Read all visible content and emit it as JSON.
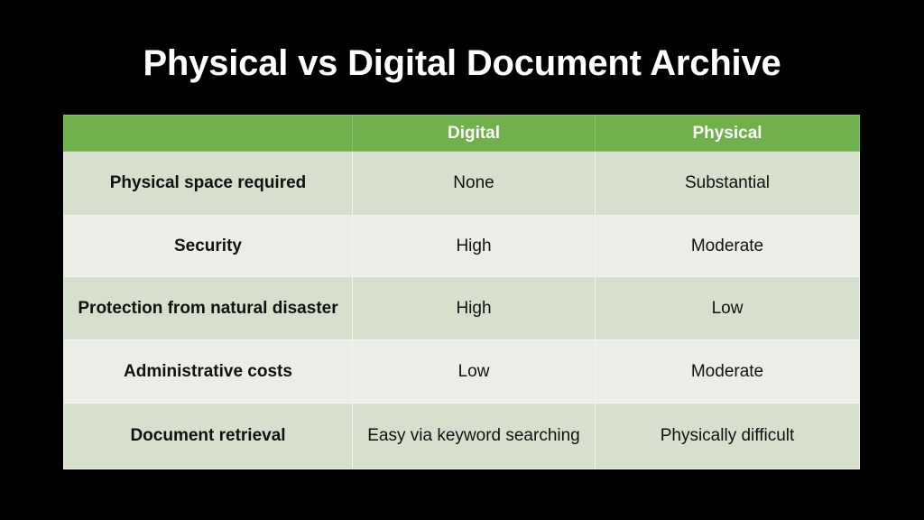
{
  "slide": {
    "title": "Physical vs Digital Document Archive",
    "background_color": "#000000",
    "title_color": "#ffffff"
  },
  "table": {
    "header_background": "#70b04a",
    "header_text_color": "#ffffff",
    "row_band_dark": "#d6e0cc",
    "row_band_light": "#eaeee6",
    "gridline_color": "#f2f6ee",
    "columns": [
      {
        "label": "",
        "key": "feature"
      },
      {
        "label": "Digital",
        "key": "digital"
      },
      {
        "label": "Physical",
        "key": "physical"
      }
    ],
    "rows": [
      {
        "feature": "Physical space required",
        "digital": "None",
        "physical": "Substantial"
      },
      {
        "feature": "Security",
        "digital": "High",
        "physical": "Moderate"
      },
      {
        "feature": "Protection from natural disaster",
        "digital": "High",
        "physical": "Low"
      },
      {
        "feature": "Administrative costs",
        "digital": "Low",
        "physical": "Moderate"
      },
      {
        "feature": "Document retrieval",
        "digital": "Easy via keyword searching",
        "physical": "Physically difficult"
      }
    ]
  }
}
